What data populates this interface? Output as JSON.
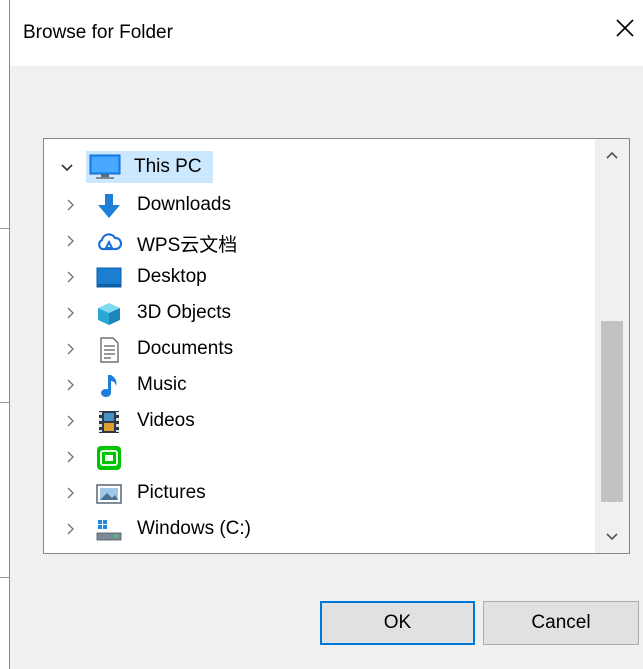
{
  "dialog": {
    "title": "Browse for Folder"
  },
  "tree": {
    "root": {
      "label": "This PC",
      "icon": "computer-icon",
      "expanded": true,
      "selected": true
    },
    "items": [
      {
        "label": "Downloads",
        "icon": "downloads-icon"
      },
      {
        "label": "WPS云文档",
        "icon": "wps-cloud-icon"
      },
      {
        "label": "Desktop",
        "icon": "desktop-icon"
      },
      {
        "label": "3D Objects",
        "icon": "3d-objects-icon"
      },
      {
        "label": "Documents",
        "icon": "documents-icon"
      },
      {
        "label": "Music",
        "icon": "music-icon"
      },
      {
        "label": "Videos",
        "icon": "videos-icon"
      },
      {
        "label": "",
        "icon": "iqiyi-icon"
      },
      {
        "label": "Pictures",
        "icon": "pictures-icon"
      },
      {
        "label": "Windows (C:)",
        "icon": "drive-icon"
      }
    ]
  },
  "buttons": {
    "ok": "OK",
    "cancel": "Cancel"
  },
  "colors": {
    "accent": "#0078d7",
    "selection": "#cce8ff"
  }
}
